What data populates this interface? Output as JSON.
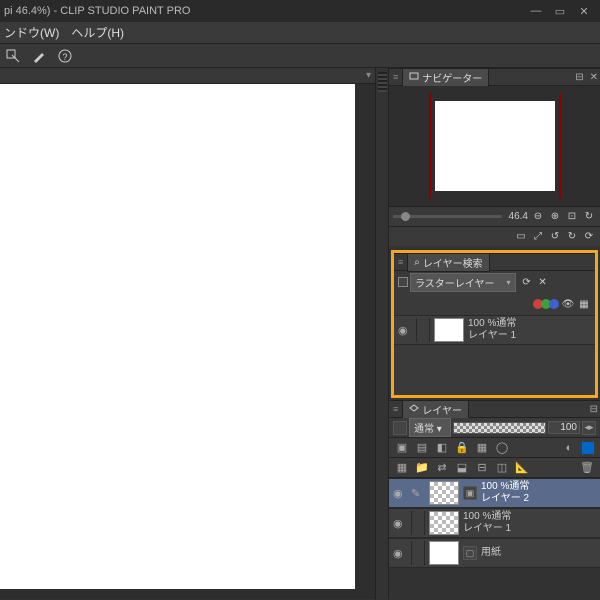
{
  "titlebar": {
    "title": "pi 46.4%)  -  CLIP STUDIO PAINT PRO"
  },
  "menu": {
    "window": "ンドウ(W)",
    "help": "ヘルプ(H)"
  },
  "navigator": {
    "label": "ナビゲーター",
    "zoom": "46.4"
  },
  "search_panel": {
    "title": "レイヤー検索",
    "type_select": "ラスターレイヤー",
    "layer": {
      "opacity_line": "100 %通常",
      "name": "レイヤー 1"
    }
  },
  "layer_panel": {
    "title": "レイヤー",
    "blend_mode": "通常",
    "opacity": "100",
    "layers": [
      {
        "opacity_line": "100 %通常",
        "name": "レイヤー 2",
        "selected": true,
        "checker": true
      },
      {
        "opacity_line": "100 %通常",
        "name": "レイヤー 1",
        "selected": false,
        "checker": true
      },
      {
        "opacity_line": "",
        "name": "用紙",
        "selected": false,
        "checker": false
      }
    ]
  }
}
